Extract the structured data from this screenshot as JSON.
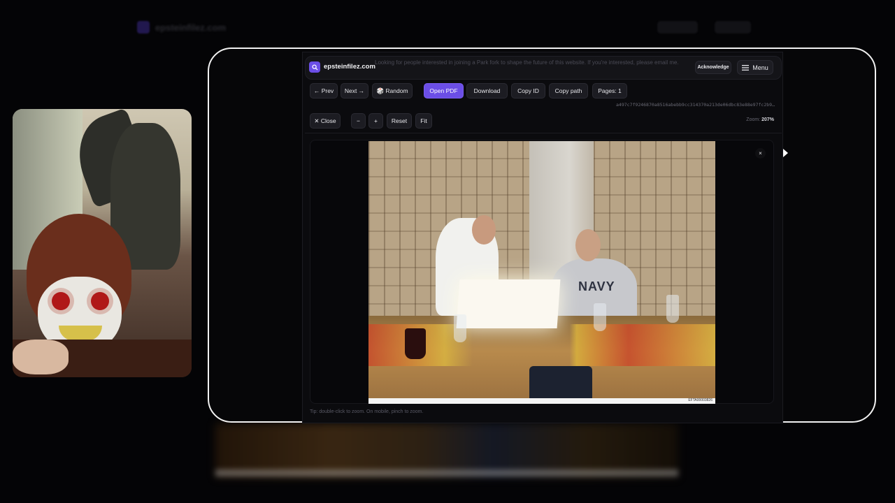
{
  "background": {
    "brand": "epsteinfilez.com"
  },
  "header": {
    "brand": "epsteinfilez.com",
    "notice": "Looking for people interested in joining a Park fork to shape the future of this website. If you're interested, please email me.",
    "acknowledge_label": "Acknowledge",
    "menu_label": "Menu"
  },
  "toolbar": {
    "prev_label": "← Prev",
    "next_label": "Next →",
    "random_label": "🎲 Random",
    "open_pdf_label": "Open PDF",
    "download_label": "Download",
    "copy_id_label": "Copy ID",
    "copy_path_label": "Copy path",
    "pages_label": "Pages: 1",
    "hash": "a497c7f9246870a8516abebb9cc314370a213de06dbc83e88e97fc2b9…"
  },
  "viewer_controls": {
    "close_label": "✕ Close",
    "zoom_out_label": "−",
    "zoom_in_label": "+",
    "reset_label": "Reset",
    "fit_label": "Fit",
    "zoom_text": "Zoom:",
    "zoom_value": "207%",
    "dismiss_label": "×"
  },
  "photo": {
    "navy_text": "NAVY",
    "stamp": "EFTA00003826"
  },
  "footer": {
    "tip": "Tip: double-click to zoom. On mobile, pinch to zoom."
  }
}
